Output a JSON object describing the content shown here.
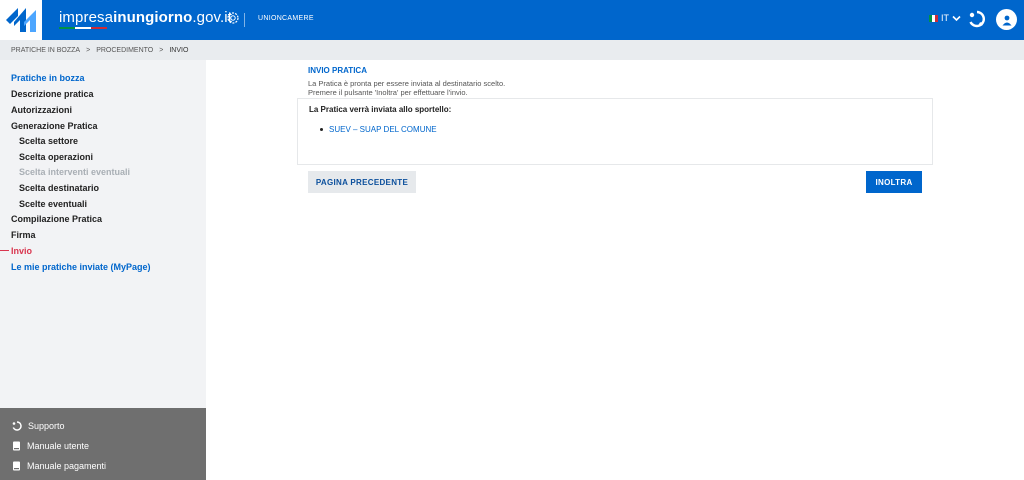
{
  "header": {
    "brand_prefix": "impresa",
    "brand_mid": "inun",
    "brand_bold": "giorno",
    "brand_suffix": ".gov.it",
    "partner": "UNIONCAMERE",
    "language": "IT",
    "icons": [
      "logo-icon",
      "unioncamere-gear-icon",
      "italy-flag-icon",
      "chevron-down-icon",
      "support-icon",
      "user-icon"
    ]
  },
  "breadcrumb": {
    "items": [
      "PRATICHE IN BOZZA",
      "PROCEDIMENTO",
      "INVIO"
    ],
    "separator": ">"
  },
  "sidebar": {
    "items": [
      {
        "label": "Pratiche in bozza",
        "state": "link"
      },
      {
        "label": "Descrizione pratica",
        "state": "normal"
      },
      {
        "label": "Autorizzazioni",
        "state": "normal"
      },
      {
        "label": "Generazione Pratica",
        "state": "normal"
      },
      {
        "label": "Scelta settore",
        "state": "sub"
      },
      {
        "label": "Scelta operazioni",
        "state": "sub"
      },
      {
        "label": "Scelta interventi eventuali",
        "state": "sub-disabled"
      },
      {
        "label": "Scelta destinatario",
        "state": "sub"
      },
      {
        "label": "Scelte eventuali",
        "state": "sub"
      },
      {
        "label": "Compilazione Pratica",
        "state": "normal"
      },
      {
        "label": "Firma",
        "state": "normal"
      },
      {
        "label": "Invio",
        "state": "active"
      },
      {
        "label": "Le mie pratiche inviate (MyPage)",
        "state": "link"
      }
    ],
    "footer": [
      {
        "label": "Supporto",
        "icon": "support-icon"
      },
      {
        "label": "Manuale utente",
        "icon": "book-icon"
      },
      {
        "label": "Manuale pagamenti",
        "icon": "book-icon"
      }
    ]
  },
  "main": {
    "title": "INVIO PRATICA",
    "desc_line1": "La Pratica è pronta per essere inviata al destinatario scelto.",
    "desc_line2": "Premere il pulsante 'Inoltra' per effettuare l'invio.",
    "panel_heading": "La Pratica verrà inviata allo sportello:",
    "recipients": [
      "SUEV – SUAP DEL COMUNE"
    ],
    "btn_prev": "PAGINA PRECEDENTE",
    "btn_next": "INOLTRA"
  },
  "colors": {
    "primary": "#0066cc",
    "active": "#d9364f",
    "disabled": "#a9afb5",
    "sidebar_bg": "#f2f3f5",
    "footer_bg": "#6f6f6f",
    "flag_green": "#009246",
    "flag_white": "#ffffff",
    "flag_red": "#ce2b37"
  }
}
